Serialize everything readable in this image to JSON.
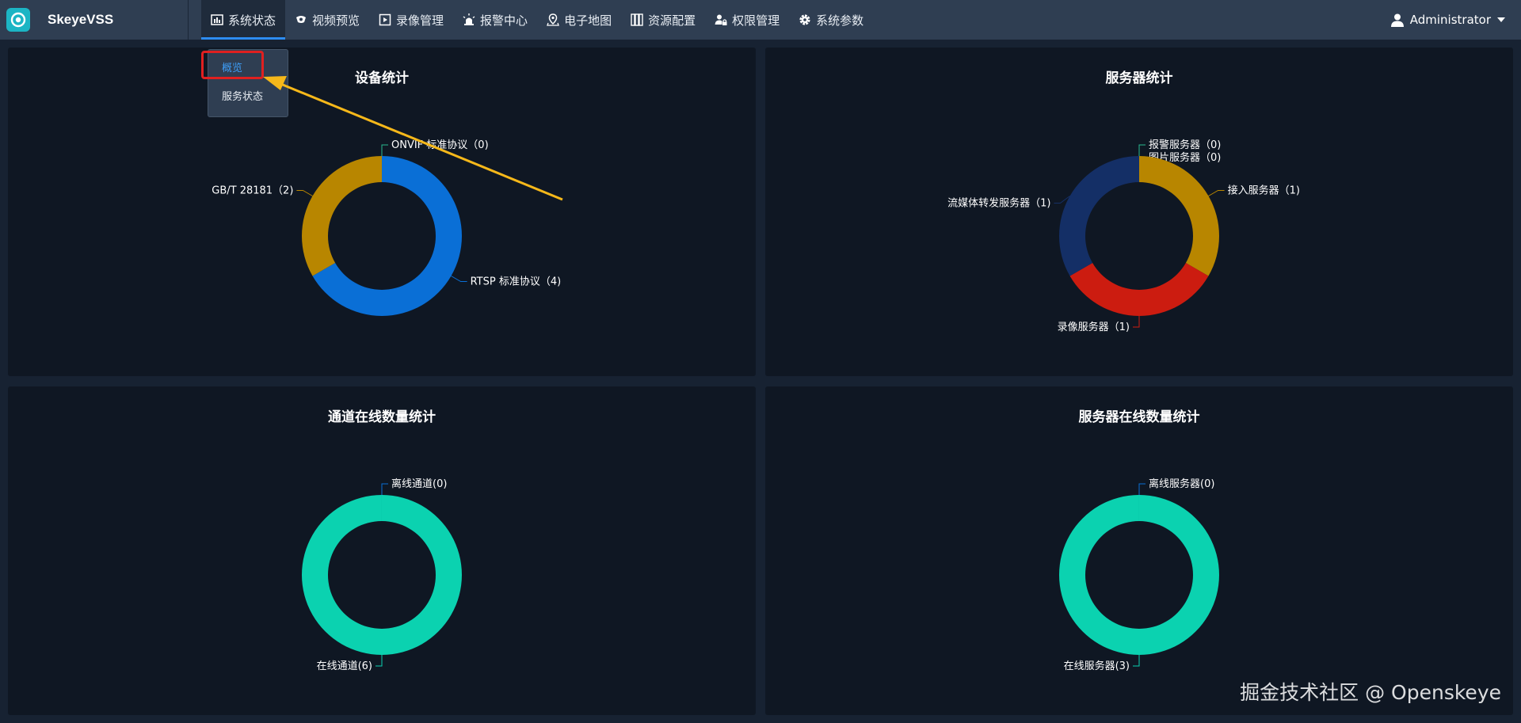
{
  "brand": {
    "name": "SkeyeVSS"
  },
  "nav": [
    {
      "label": "系统状态",
      "icon": "bar-chart-icon",
      "active": true
    },
    {
      "label": "视频预览",
      "icon": "camera-icon",
      "active": false
    },
    {
      "label": "录像管理",
      "icon": "video-file-icon",
      "active": false
    },
    {
      "label": "报警中心",
      "icon": "alarm-light-icon",
      "active": false
    },
    {
      "label": "电子地图",
      "icon": "map-icon",
      "active": false
    },
    {
      "label": "资源配置",
      "icon": "server-rack-icon",
      "active": false
    },
    {
      "label": "权限管理",
      "icon": "user-lock-icon",
      "active": false
    },
    {
      "label": "系统参数",
      "icon": "gear-icon",
      "active": false
    }
  ],
  "user": {
    "name": "Administrator"
  },
  "dropdown": {
    "items": [
      "概览",
      "服务状态"
    ],
    "active_index": 0
  },
  "panels": {
    "device_stats": {
      "title": "设备统计"
    },
    "server_stats": {
      "title": "服务器统计"
    },
    "channel_online": {
      "title": "通道在线数量统计"
    },
    "server_online": {
      "title": "服务器在线数量统计"
    }
  },
  "chart_data": [
    {
      "type": "pie",
      "title": "设备统计",
      "categories": [
        "ONVIF 标准协议",
        "RTSP 标准协议",
        "GB/T 28181"
      ],
      "values": [
        0,
        4,
        2
      ],
      "labels": [
        "ONVIF 标准协议（0)",
        "RTSP 标准协议（4)",
        "GB/T 28181（2)"
      ],
      "colors": [
        "#2ab88f",
        "#0a6fd6",
        "#b88600"
      ]
    },
    {
      "type": "pie",
      "title": "服务器统计",
      "categories": [
        "报警服务器",
        "图片服务器",
        "接入服务器",
        "录像服务器",
        "流媒体转发服务器"
      ],
      "values": [
        0,
        0,
        1,
        1,
        1
      ],
      "labels": [
        "报警服务器（0)",
        "图片服务器（0)",
        "接入服务器（1)",
        "录像服务器（1)",
        "流媒体转发服务器（1)"
      ],
      "colors": [
        "#2ab88f",
        "#0a6fd6",
        "#b88600",
        "#cc1c10",
        "#142f66"
      ]
    },
    {
      "type": "pie",
      "title": "通道在线数量统计",
      "categories": [
        "离线通道",
        "在线通道"
      ],
      "values": [
        0,
        6
      ],
      "labels": [
        "离线通道(0)",
        "在线通道(6)"
      ],
      "colors": [
        "#0a6fd6",
        "#0bd2b0"
      ]
    },
    {
      "type": "pie",
      "title": "服务器在线数量统计",
      "categories": [
        "离线服务器",
        "在线服务器"
      ],
      "values": [
        0,
        3
      ],
      "labels": [
        "离线服务器(0)",
        "在线服务器(3)"
      ],
      "colors": [
        "#0a6fd6",
        "#0bd2b0"
      ]
    }
  ],
  "watermark": "掘金技术社区 @ Openskeye"
}
